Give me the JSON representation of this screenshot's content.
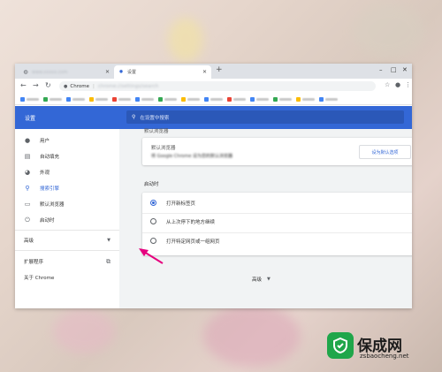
{
  "tabs": [
    {
      "label": "www.xxxxx.com"
    },
    {
      "label": "设置"
    }
  ],
  "newtab_label": "+",
  "window_controls": {
    "minimize": "–",
    "maximize": "□",
    "close": "✕"
  },
  "address": {
    "site": "Chrome",
    "url": "chrome://settings/search"
  },
  "header": {
    "title": "设置",
    "search_placeholder": "在设置中搜索"
  },
  "sidebar": {
    "items": [
      {
        "label": "用户",
        "icon": "person-icon"
      },
      {
        "label": "自动填充",
        "icon": "clipboard-icon"
      },
      {
        "label": "外观",
        "icon": "palette-icon"
      },
      {
        "label": "搜索引擎",
        "icon": "search-icon"
      },
      {
        "label": "默认浏览器",
        "icon": "browser-icon"
      },
      {
        "label": "启动时",
        "icon": "power-icon"
      }
    ],
    "advanced": "高级",
    "extensions": "扩展程序",
    "about": "关于 Chrome"
  },
  "default_browser": {
    "section_title": "默认浏览器",
    "card_title": "默认浏览器",
    "card_sub": "将 Google Chrome 设为您的默认浏览器",
    "button": "设为默认选项"
  },
  "on_startup": {
    "section_title": "启动时",
    "options": [
      {
        "label": "打开新标签页",
        "selected": true
      },
      {
        "label": "从上次停下的地方继续",
        "selected": false
      },
      {
        "label": "打开特定网页或一组网页",
        "selected": false
      }
    ]
  },
  "advanced_footer": "高级",
  "colors": {
    "accent": "#3367d6",
    "annotation_arrow": "#e6007e"
  }
}
